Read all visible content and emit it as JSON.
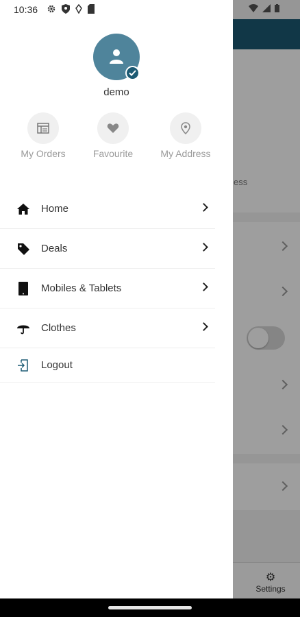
{
  "status_bar": {
    "time": "10:36"
  },
  "drawer": {
    "username": "demo",
    "quick_actions": [
      {
        "label": "My Orders",
        "icon": "orders-icon"
      },
      {
        "label": "Favourite",
        "icon": "heart-icon"
      },
      {
        "label": "My Address",
        "icon": "location-pin-icon"
      }
    ],
    "menu": [
      {
        "label": "Home",
        "icon": "home-icon"
      },
      {
        "label": "Deals",
        "icon": "tag-icon"
      },
      {
        "label": "Mobiles & Tablets",
        "icon": "tablet-icon"
      },
      {
        "label": "Clothes",
        "icon": "umbrella-icon"
      }
    ],
    "logout_label": "Logout"
  },
  "background": {
    "partial_text": "ess",
    "settings_label": "Settings"
  },
  "colors": {
    "primary": "#1c5a73",
    "avatar": "#4f849b"
  }
}
